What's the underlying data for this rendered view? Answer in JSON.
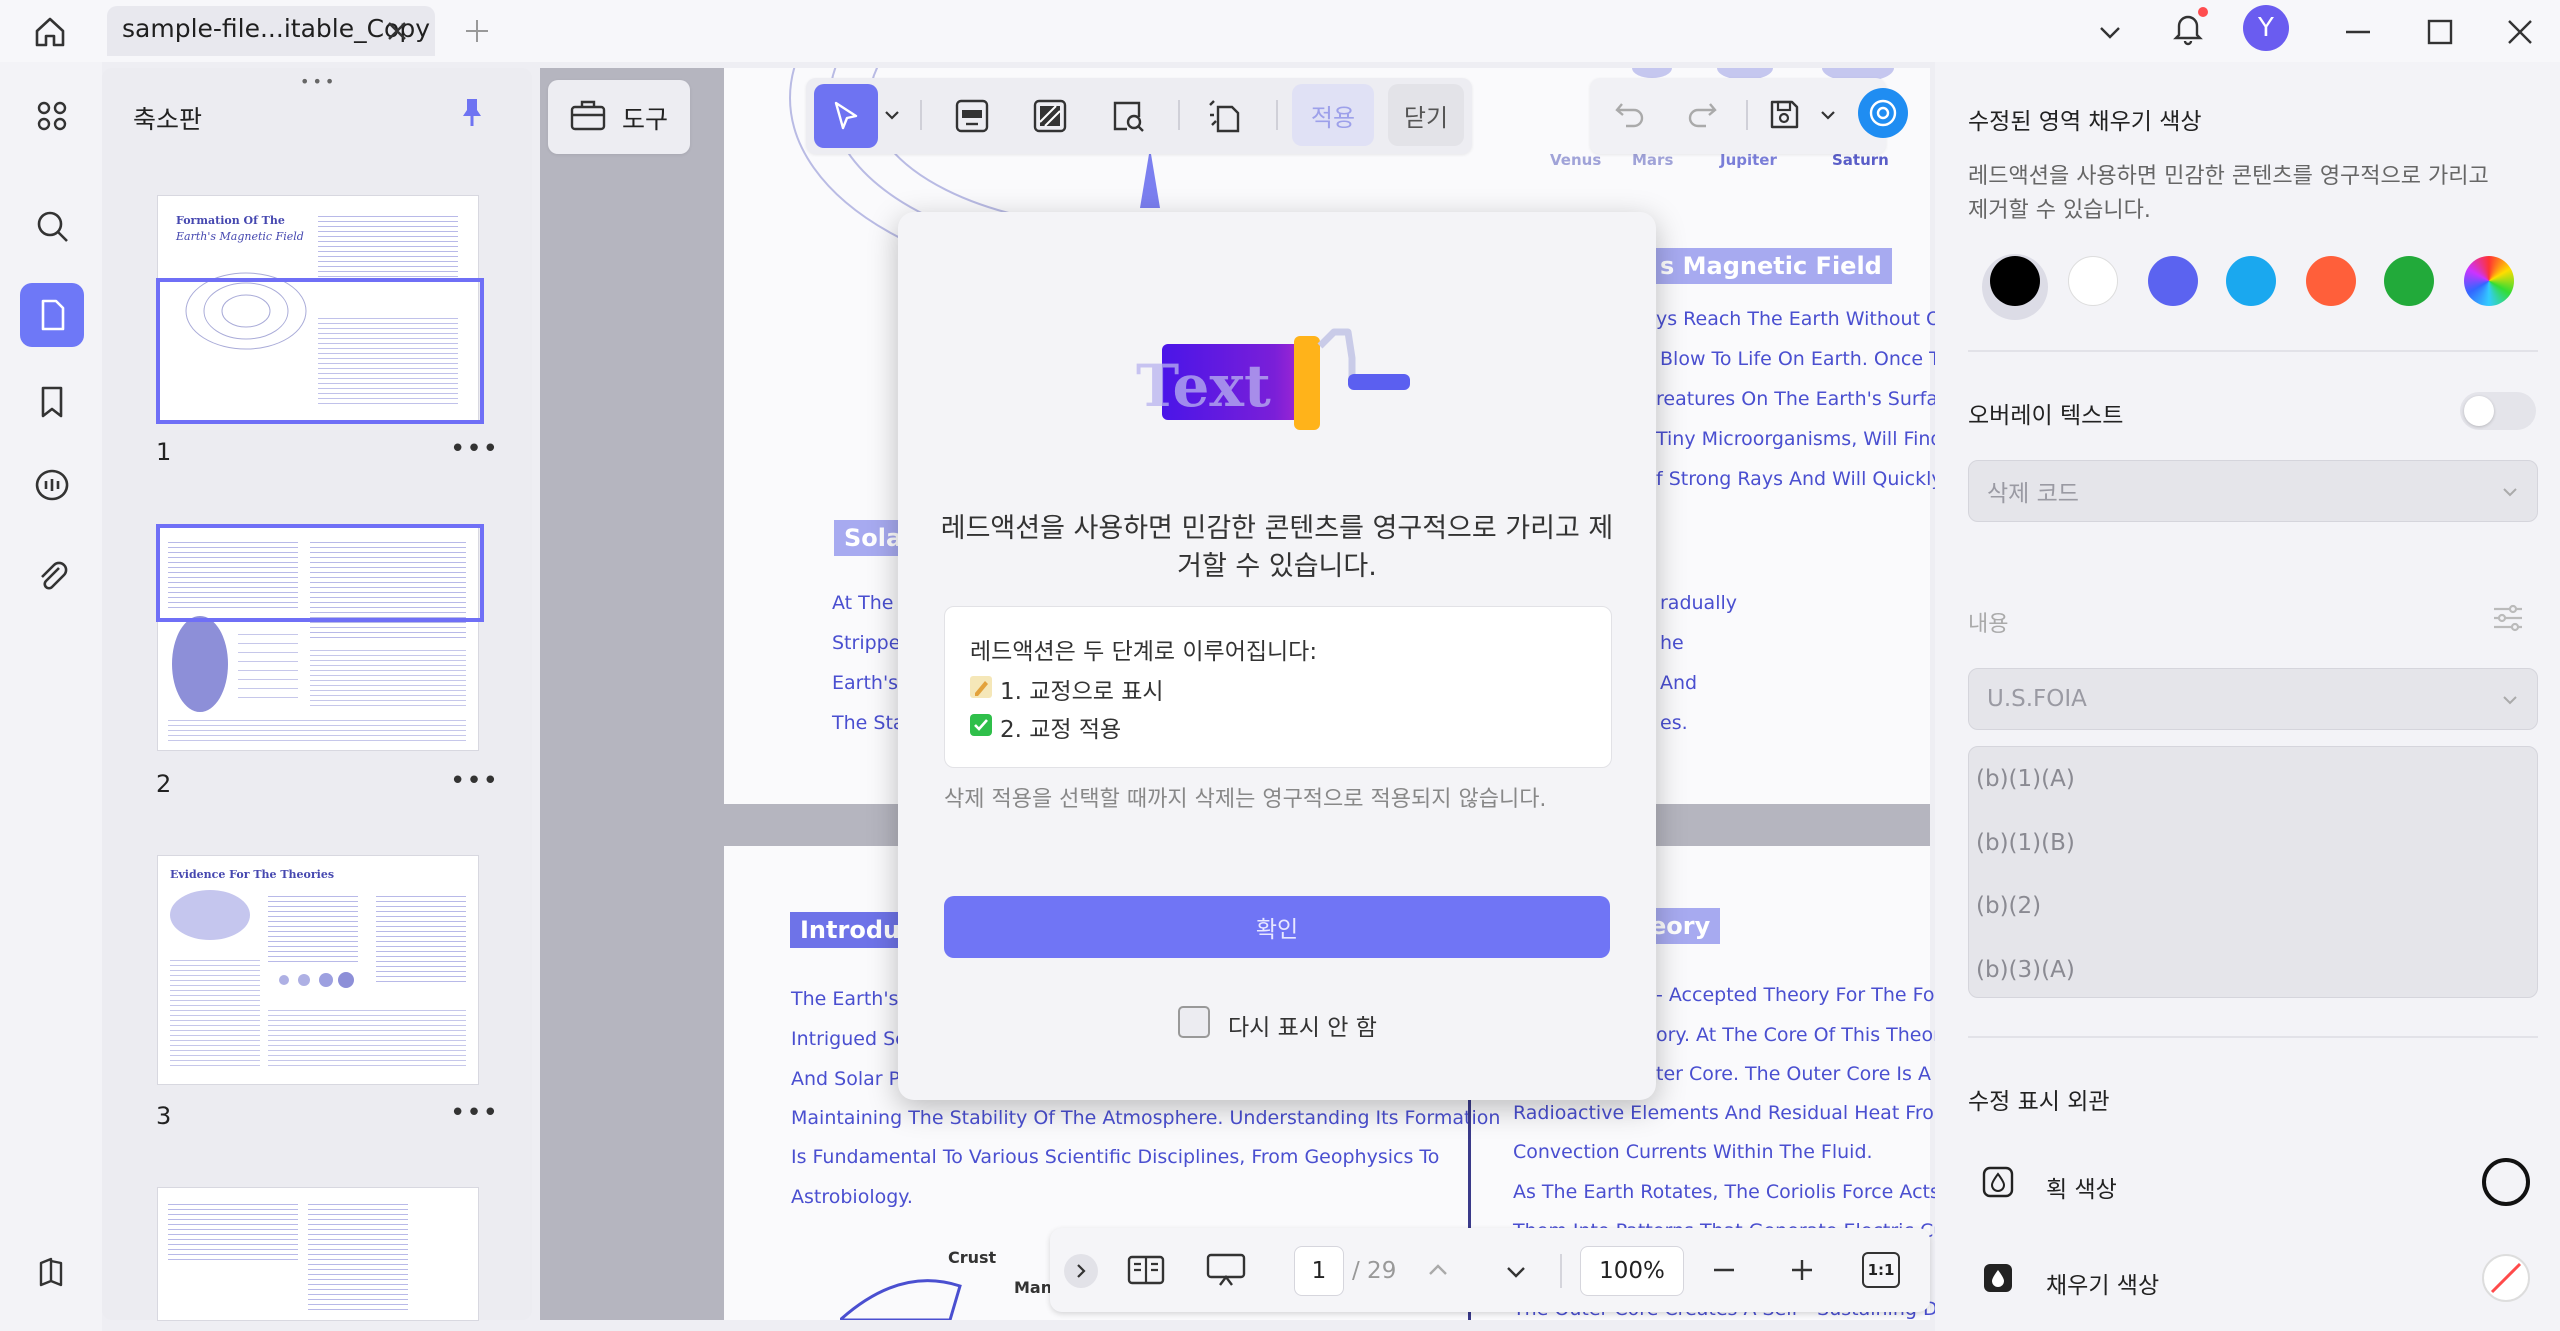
{
  "app": {
    "tab_title": "sample-file...itable_Copy",
    "user_initial": "Y"
  },
  "thumbnails": {
    "title": "축소판",
    "pages": [
      {
        "number": "1",
        "heading_line1": "Formation Of The",
        "heading_line2": "Earth's Magnetic Field"
      },
      {
        "number": "2"
      },
      {
        "number": "3",
        "heading_line1": "Evidence For The Theories"
      }
    ]
  },
  "toolbar": {
    "tools_label": "도구",
    "apply_label": "적용",
    "close_label": "닫기"
  },
  "document": {
    "planet_labels": [
      "Venus",
      "Mars",
      "Jupiter",
      "Saturn"
    ],
    "heading_magnetic": "s Magnetic Field",
    "magnetic_lines": [
      "ys Reach The Earth Without Obst",
      "Blow To Life On Earth. Once The",
      "reatures On The Earth's Surface,",
      "Tiny Microorganisms, Will Find It D",
      "f Strong Rays And Will Quickly Go"
    ],
    "heading_solar": "Solar",
    "solar_lines_left": [
      "At The S",
      "Strippe",
      "Earth's",
      "The Sta"
    ],
    "solar_lines_right": [
      "radually",
      "he",
      "And",
      "es."
    ],
    "heading_intro": "Introduc",
    "intro_lines_partial": [
      "The Earth's M",
      "Intrigued Sci",
      "And Solar Pa"
    ],
    "intro_lines_full": [
      "Maintaining The Stability Of The Atmosphere. Understanding Its Formation",
      "Is Fundamental To Various Scientific Disciplines, From Geophysics To",
      "Astrobiology."
    ],
    "heading_theory": "eory",
    "theory_lines": [
      "- Accepted Theory For The Forma",
      "ory. At The Core Of This Theory Is",
      "ter Core. The Outer Core Is A Flu",
      "Radioactive Elements And Residual Heat From Th",
      "Convection Currents Within The Fluid.",
      "As The Earth Rotates, The Coriolis Force Acts On T",
      "Them Into Patterns That Generate Electric Currents",
      "The Outer Core Creates A Self - Sustaining Dynam"
    ],
    "diagram_labels": [
      "Crust",
      "Mant"
    ]
  },
  "modal": {
    "illustration_text": "Text",
    "message": "레드액션을 사용하면 민감한 콘텐츠를 영구적으로 가리고 제거할 수 있습니다.",
    "steps_title": "레드액션은 두 단계로 이루어집니다:",
    "step1": "1. 교정으로 표시",
    "step2": "2. 교정 적용",
    "note": "삭제 적용을 선택할 때까지 삭제는 영구적으로 적용되지 않습니다.",
    "confirm_label": "확인",
    "dont_show_label": "다시 표시 안 함"
  },
  "right_panel": {
    "fill_color_title": "수정된 영역 채우기 색상",
    "fill_color_desc": "레드액션을 사용하면 민감한 콘텐츠를 영구적으로 가리고 제거할 수 있습니다.",
    "swatches": [
      "#000000",
      "#ffffff",
      "#5b63f0",
      "#1aa8ef",
      "#ff5f3a",
      "#22aa3a",
      "rainbow"
    ],
    "overlay_text_label": "오버레이 텍스트",
    "overlay_toggle_on": false,
    "delete_code_placeholder": "삭제 코드",
    "content_label": "내용",
    "code_select_value": "U.S.FOIA",
    "codes": [
      "(b)(1)(A)",
      "(b)(1)(B)",
      "(b)(2)",
      "(b)(3)(A)"
    ],
    "appearance_title": "수정 표시 외관",
    "stroke_color_label": "획 색상",
    "fill_color_label": "채우기 색상"
  },
  "bottom_bar": {
    "page_current": "1",
    "page_total": "/ 29",
    "zoom": "100%",
    "fit_label": "1:1"
  }
}
